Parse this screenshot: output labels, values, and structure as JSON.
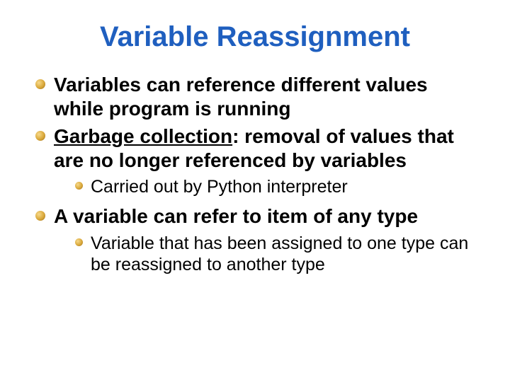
{
  "title": "Variable Reassignment",
  "bullets": {
    "b1": "Variables can reference different values while program is running",
    "b2_term": "Garbage collection",
    "b2_rest": ": removal of values that are no longer referenced by variables",
    "b2_sub1": "Carried out by Python interpreter",
    "b3": "A variable can refer to item of any type",
    "b3_sub1": "Variable that has been assigned to one type can be reassigned to another type"
  }
}
